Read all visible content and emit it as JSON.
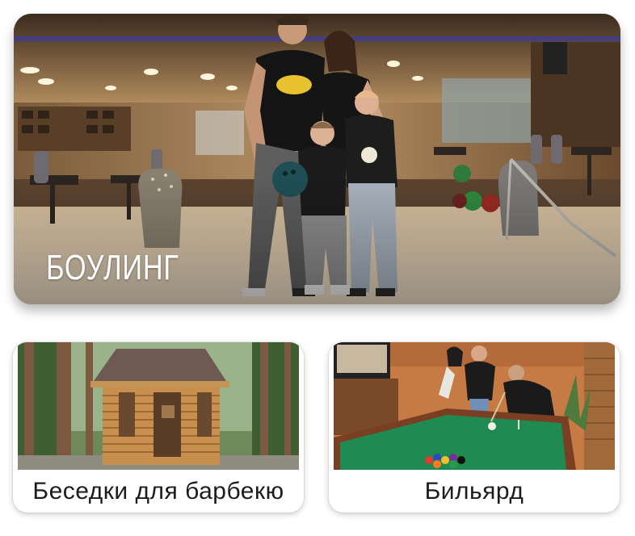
{
  "cards": {
    "bowling": {
      "title": "БОУЛИНГ"
    },
    "gazebos": {
      "title": "Беседки для барбекю"
    },
    "billiards": {
      "title": "Бильярд"
    }
  }
}
